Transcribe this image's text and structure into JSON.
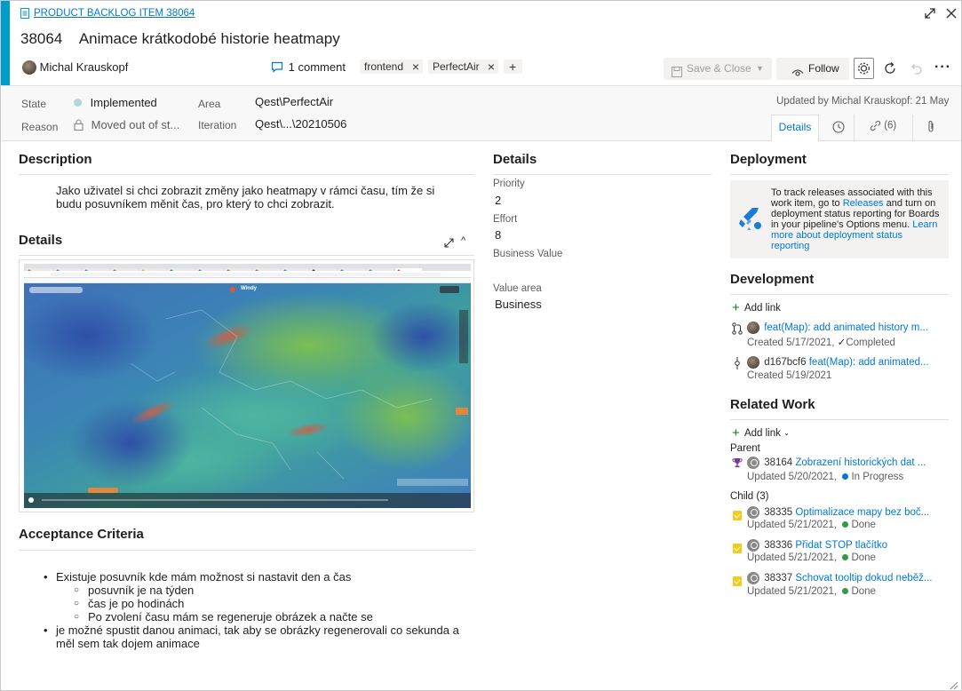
{
  "header": {
    "type_label": "PRODUCT BACKLOG ITEM 38064",
    "id": "38064",
    "title": "Animace krátkodobé historie heatmapy",
    "assignee": "Michal Krauskopf",
    "comments": "1 comment",
    "tags": [
      "frontend",
      "PerfectAir"
    ],
    "add_tag": "+",
    "save_close": "Save & Close",
    "follow": "Follow",
    "updated": "Updated by Michal Krauskopf: 21 May"
  },
  "fields": {
    "state_label": "State",
    "state_value": "Implemented",
    "reason_label": "Reason",
    "reason_value": "Moved out of st...",
    "area_label": "Area",
    "area_value": "Qest\\PerfectAir",
    "iteration_label": "Iteration",
    "iteration_value": "Qest\\...\\20210506"
  },
  "tabs": {
    "details": "Details",
    "links": "(6)"
  },
  "description": {
    "title": "Description",
    "text": "Jako uživatel si chci zobrazit změny jako heatmapy v rámci času, tím že si budu posuvníkem měnit čas, pro který to chci zobrazit."
  },
  "details_section": {
    "title": "Details",
    "map_app": "Windy"
  },
  "acceptance": {
    "title": "Acceptance Criteria",
    "item1": "Existuje posuvník kde mám možnost si nastavit den a čas",
    "sub1": "posuvník je na týden",
    "sub2": "čas je po hodinách",
    "sub3": "Po zvolení času mám se regeneruje obrázek a načte se",
    "item2": "je možné spustit danou animaci, tak aby se obrázky regenerovali co sekunda a měl sem tak dojem animace"
  },
  "details_panel": {
    "title": "Details",
    "priority_label": "Priority",
    "priority_value": "2",
    "effort_label": "Effort",
    "effort_value": "8",
    "business_value_label": "Business Value",
    "value_area_label": "Value area",
    "value_area_value": "Business"
  },
  "deployment": {
    "title": "Deployment",
    "text1": "To track releases associated with this work item, go to ",
    "releases": "Releases",
    "text2": " and turn on deployment status reporting for Boards in your pipeline's Options menu. ",
    "learn_more": "Learn more about deployment status reporting"
  },
  "development": {
    "title": "Development",
    "add_link": "Add link",
    "pr_title": "feat(Map): add animated history m...",
    "pr_created": "Created 5/17/2021,",
    "pr_status": "Completed",
    "commit_hash": "d167bcf6",
    "commit_title": "feat(Map): add animated...",
    "commit_created": "Created 5/19/2021"
  },
  "related": {
    "title": "Related Work",
    "add_link": "Add link",
    "parent_label": "Parent",
    "parent": {
      "id": "38164",
      "title": "Zobrazení historických dat ...",
      "updated": "Updated 5/20/2021,",
      "state": "In Progress",
      "state_color": "#0078d4"
    },
    "child_label": "Child (3)",
    "children": [
      {
        "id": "38335",
        "title": "Optimalizace mapy bez boč...",
        "updated": "Updated 5/21/2021,",
        "state": "Done",
        "state_color": "#339947"
      },
      {
        "id": "38336",
        "title": "Přidat STOP tlačítko",
        "updated": "Updated 5/21/2021,",
        "state": "Done",
        "state_color": "#339947"
      },
      {
        "id": "38337",
        "title": "Schovat tooltip dokud neběž...",
        "updated": "Updated 5/21/2021,",
        "state": "Done",
        "state_color": "#339947"
      }
    ]
  },
  "colors": {
    "accent": "#009ccc",
    "link": "#0078d4",
    "implemented": "#b2d7d5"
  }
}
